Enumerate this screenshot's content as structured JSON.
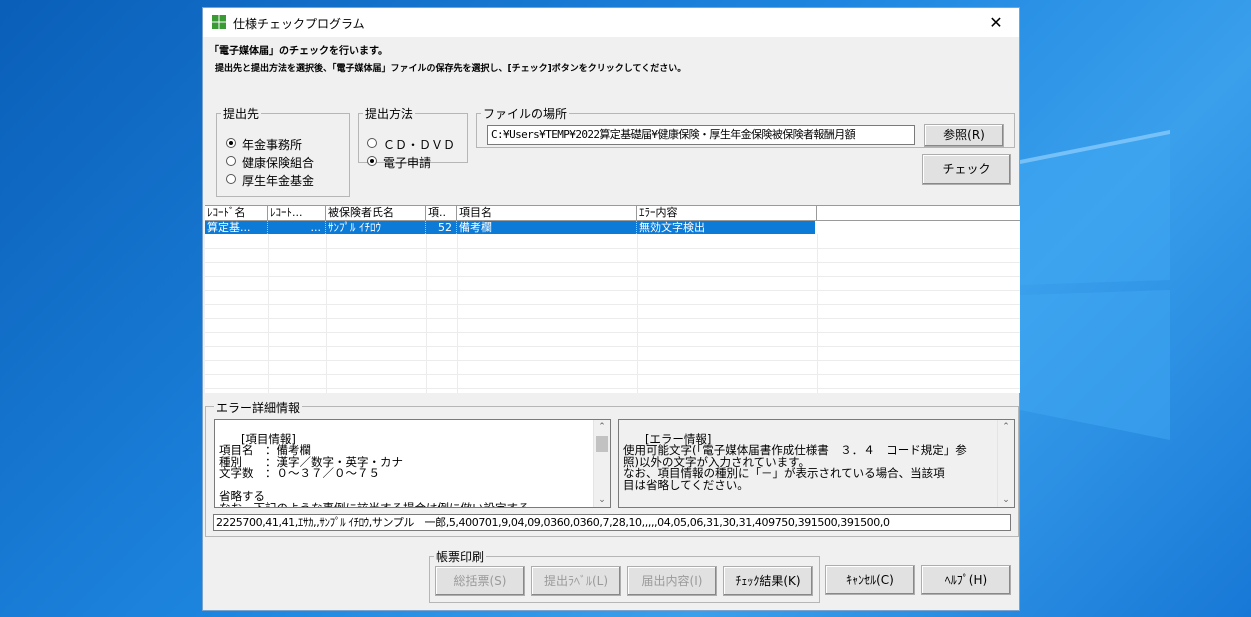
{
  "window": {
    "title": "仕様チェックプログラム",
    "close": "✕"
  },
  "intro": {
    "line1": "「電子媒体届」のチェックを行います。",
    "line2": "提出先と提出方法を選択後、「電子媒体届」ファイルの保存先を選択し、[チェック]ボタンをクリックしてください。"
  },
  "destination": {
    "legend": "提出先",
    "options": [
      {
        "label": "年金事務所",
        "checked": true
      },
      {
        "label": "健康保険組合",
        "checked": false
      },
      {
        "label": "厚生年金基金",
        "checked": false
      }
    ]
  },
  "method": {
    "legend": "提出方法",
    "options": [
      {
        "label": "ＣＤ・ＤＶＤ",
        "checked": false
      },
      {
        "label": "電子申請",
        "checked": true
      }
    ]
  },
  "file": {
    "legend": "ファイルの場所",
    "path": "C:¥Users¥TEMP¥2022算定基礎届¥健康保険・厚生年金保険被保険者報酬月額",
    "browse_label": "参照(R)"
  },
  "check_button": "チェック",
  "grid": {
    "columns": [
      "ﾚｺｰﾄﾞ名",
      "ﾚｺｰﾄ...",
      "被保険者氏名",
      "項..",
      "項目名",
      "ｴﾗｰ内容"
    ],
    "rows": [
      [
        "算定基...",
        "...",
        "ｻﾝﾌﾟﾙ ｲﾁﾛｳ",
        "52",
        "備考欄",
        "無効文字検出"
      ]
    ]
  },
  "error_detail": {
    "legend": "エラー詳細情報",
    "item_info": "[項目情報]\n項目名　：備考欄\n種別　　：漢字／数字・英字・カナ\n文字数　：０～３７／０～７５\n\n省略する\nなお、下記のような事例に該当する場合は例に倣い設定する",
    "error_info": "[エラー情報]\n使用可能文字(「電子媒体届書作成仕様書　３．４　コード規定」参\n照)以外の文字が入力されています。\nなお、項目情報の種別に「－」が表示されている場合、当該項\n目は省略してください。",
    "data_line": "2225700,41,41,ｴｻｶ,,ｻﾝﾌﾟﾙ ｲﾁﾛｳ,サンプル　一郎,5,400701,9,04,09,0360,0360,7,28,10,,,,,04,05,06,31,30,31,409750,391500,391500,0"
  },
  "print": {
    "legend": "帳票印刷",
    "summary": "総括票(S)",
    "label": "提出ﾗﾍﾞﾙ(L)",
    "contents": "届出内容(I)",
    "result": "ﾁｪｯｸ結果(K)"
  },
  "cancel_label": "ｷｬﾝｾﾙ(C)",
  "help_label": "ﾍﾙﾌﾟ(H)"
}
